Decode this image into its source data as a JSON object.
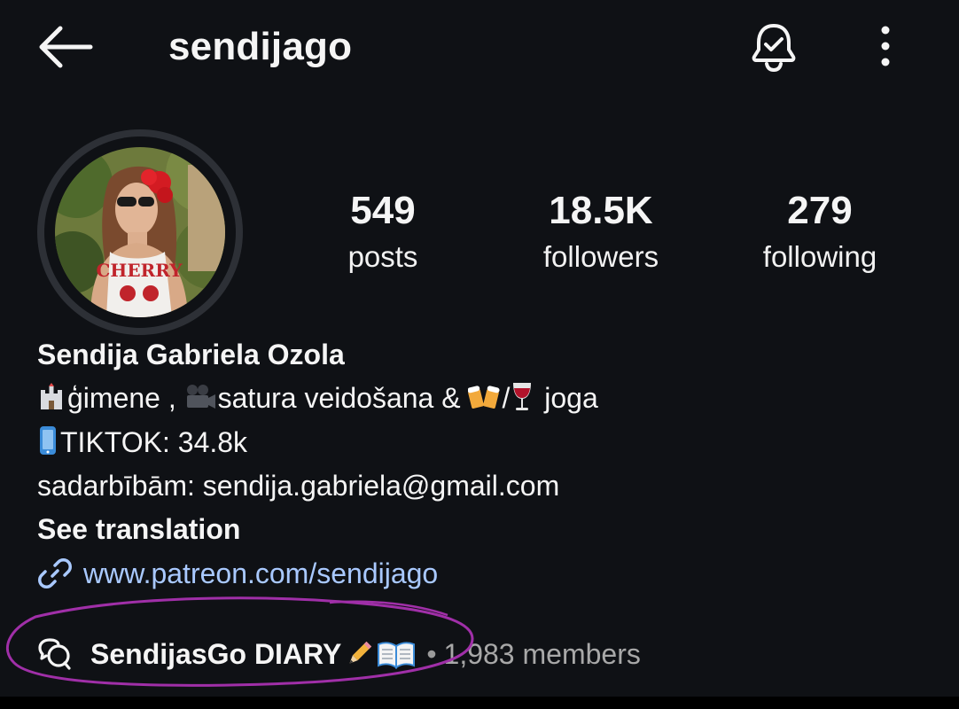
{
  "header": {
    "username": "sendijago",
    "back_icon": "arrow-left-icon",
    "notification_icon": "bell-check-icon",
    "more_icon": "more-vertical-icon"
  },
  "profile": {
    "avatar_alt": "profile-photo",
    "stats": [
      {
        "value": "549",
        "label": "posts"
      },
      {
        "value": "18.5K",
        "label": "followers"
      },
      {
        "value": "279",
        "label": "following"
      }
    ]
  },
  "bio": {
    "full_name": "Sendija Gabriela Ozola",
    "line1_part1": "ģimene , ",
    "line1_part2": "satura veidošana & ",
    "line1_part3": "/",
    "line1_part4": " joga",
    "line2": "TIKTOK: 34.8k",
    "line3": "sadarbībām: sendija.gabriela@gmail.com",
    "see_translation": "See translation",
    "link": "www.patreon.com/sendijago"
  },
  "channel": {
    "name": "SendijasGo DIARY",
    "separator": "•",
    "members": "1,983 members"
  },
  "colors": {
    "background": "#0f1115",
    "text": "#f5f5f5",
    "link": "#a9c9ff",
    "muted": "#a8a8a8",
    "highlight_oval": "#a02fa8"
  }
}
